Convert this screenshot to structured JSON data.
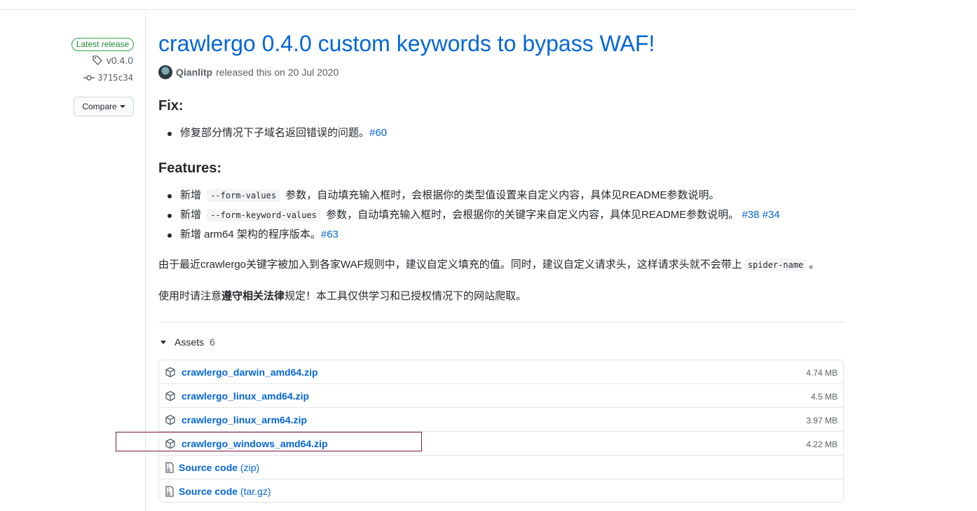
{
  "sidebar": {
    "latest_badge": "Latest release",
    "tag": "v0.4.0",
    "commit": "3715c34",
    "compare_label": "Compare"
  },
  "release": {
    "title": "crawlergo 0.4.0 custom keywords to bypass WAF!",
    "author": "Qianlitp",
    "released_text": "released this on 20 Jul 2020"
  },
  "fix": {
    "heading": "Fix:",
    "items": [
      {
        "text": "修复部分情况下子域名返回错误的问题。",
        "link": "#60"
      }
    ]
  },
  "features": {
    "heading": "Features:",
    "items": [
      {
        "prefix": "新增",
        "code": "--form-values",
        "text": "参数，自动填充输入框时，会根据你的类型值设置来自定义内容，具体见README参数说明。"
      },
      {
        "prefix": "新增",
        "code": "--form-keyword-values",
        "text": "参数，自动填充输入框时，会根据你的关键字来自定义内容，具体见README参数说明。",
        "links": [
          "#38",
          "#34"
        ]
      },
      {
        "text": "新增 arm64 架构的程序版本。",
        "link": "#63"
      }
    ]
  },
  "notes": {
    "line1": "由于最近crawlergo关键字被加入到各家WAF规则中，建议自定义填充的值。同时，建议自定义请求头，这样请求头就不会带上",
    "code": "spider-name",
    "line1_end": "。",
    "line2_pre": "使用时请注意",
    "line2_bold": "遵守相关法律",
    "line2_post": "规定！本工具仅供学习和已授权情况下的网站爬取。"
  },
  "assets": {
    "label": "Assets",
    "count": "6",
    "files": [
      {
        "name": "crawlergo_darwin_amd64.zip",
        "size": "4.74 MB"
      },
      {
        "name": "crawlergo_linux_amd64.zip",
        "size": "4.5 MB"
      },
      {
        "name": "crawlergo_linux_arm64.zip",
        "size": "3.97 MB"
      },
      {
        "name": "crawlergo_windows_amd64.zip",
        "size": "4.22 MB"
      }
    ],
    "sources": [
      {
        "name": "Source code",
        "ext": "(zip)"
      },
      {
        "name": "Source code",
        "ext": "(tar.gz)"
      }
    ]
  },
  "colors": {
    "link": "#0366d6",
    "badge_green": "#28a745",
    "highlight": "#7a1a3a"
  }
}
